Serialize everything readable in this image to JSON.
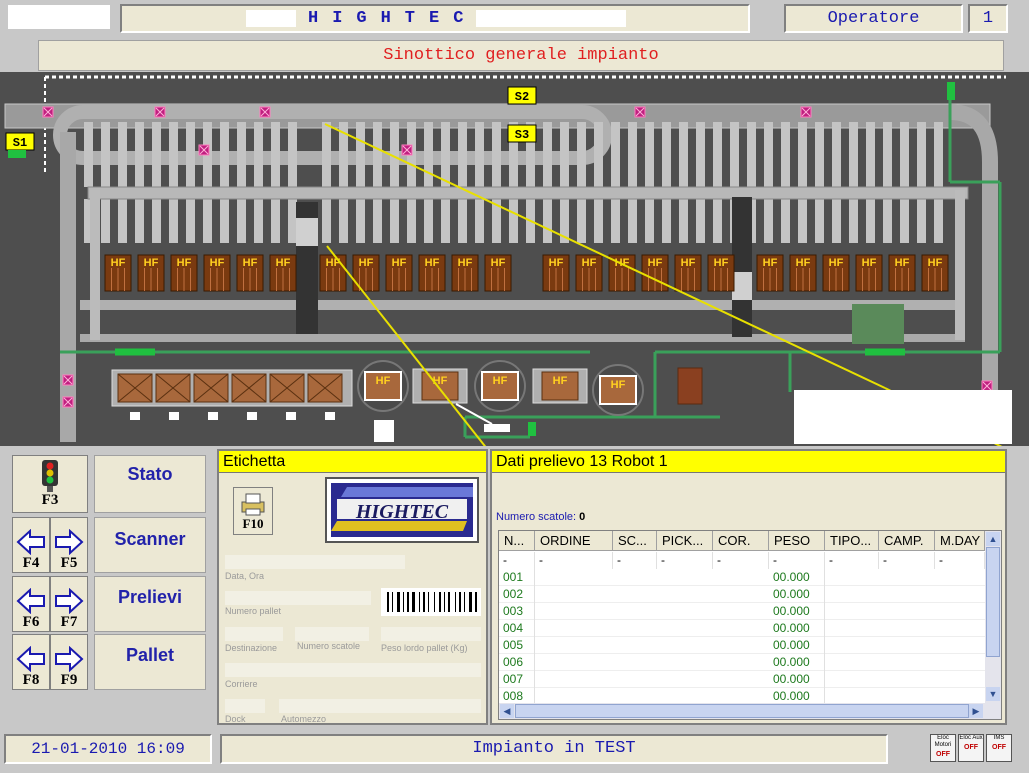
{
  "header": {
    "title": "HIGHTEC",
    "operator_label": "Operatore",
    "operator_number": "1"
  },
  "synoptic": {
    "title": "Sinottico generale impianto",
    "station_labels": [
      "S1",
      "S2",
      "S3"
    ],
    "cell_label": "HF"
  },
  "function_keys": {
    "f3": "F3",
    "f4": "F4",
    "f5": "F5",
    "f6": "F6",
    "f7": "F7",
    "f8": "F8",
    "f9": "F9",
    "f10": "F10"
  },
  "menu": {
    "stato": "Stato",
    "scanner": "Scanner",
    "prelievi": "Prelievi",
    "pallet": "Pallet"
  },
  "label_panel": {
    "title": "Etichetta",
    "logo_text": "HIGHTEC",
    "date_label": "Data, Ora",
    "pallet_number_label": "Numero pallet",
    "destination_label": "Destinazione",
    "box_count_label": "Numero scatole",
    "gross_weight_label": "Peso lordo pallet (Kg)",
    "courier_label": "Corriere",
    "dock_label": "Dock",
    "vehicle_label": "Automezzo"
  },
  "pick_panel": {
    "title": "Dati prelievo 13 Robot 1",
    "box_count_label": "Numero scatole:",
    "box_count_value": "0",
    "columns": [
      "N...",
      "ORDINE",
      "SC...",
      "PICK...",
      "COR.",
      "PESO",
      "TIPO...",
      "CAMP.",
      "M.DAY"
    ],
    "header_row": [
      "-",
      "-",
      "-",
      "-",
      "-",
      "-",
      "-",
      "-",
      "-"
    ],
    "rows": [
      {
        "n": "001",
        "peso": "00.000"
      },
      {
        "n": "002",
        "peso": "00.000"
      },
      {
        "n": "003",
        "peso": "00.000"
      },
      {
        "n": "004",
        "peso": "00.000"
      },
      {
        "n": "005",
        "peso": "00.000"
      },
      {
        "n": "006",
        "peso": "00.000"
      },
      {
        "n": "007",
        "peso": "00.000"
      },
      {
        "n": "008",
        "peso": "00.000"
      }
    ]
  },
  "status": {
    "datetime": "21-01-2010 16:09",
    "message": "Impianto in TEST",
    "icons": [
      {
        "label": "Eloc Motori",
        "state": "OFF"
      },
      {
        "label": "Eloc Aux",
        "state": "OFF"
      },
      {
        "label": "IMS",
        "state": "OFF"
      }
    ]
  },
  "colors": {
    "panel_head": "#ffff00",
    "title_blue": "#1a1ab0",
    "subtitle_red": "#e02020",
    "synoptic_bg": "#4e4e4e",
    "row_green": "#1e7a1e"
  }
}
